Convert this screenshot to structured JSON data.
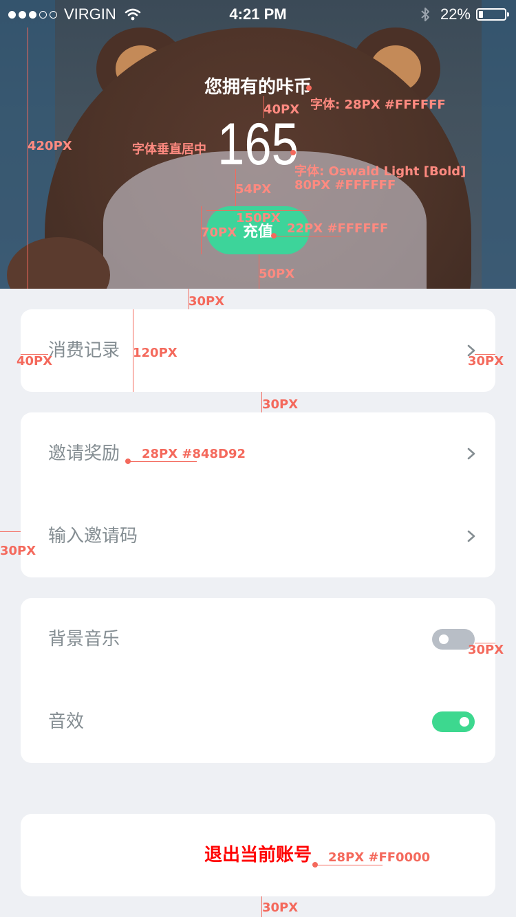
{
  "status_bar": {
    "carrier": "VIRGIN",
    "time": "4:21 PM",
    "battery": "22%",
    "battery_level": 0.22,
    "signal_bars": 3,
    "icons": [
      "wifi-icon",
      "bluetooth-icon",
      "battery-icon"
    ]
  },
  "header": {
    "title": "您拥有的咔币",
    "coin_amount": "165",
    "recharge_label": "充值"
  },
  "menu": {
    "records_label": "消费记录",
    "invite_reward_label": "邀请奖励",
    "enter_invite_code_label": "输入邀请码"
  },
  "settings": {
    "bgm_label": "背景音乐",
    "bgm_on": false,
    "sfx_label": "音效",
    "sfx_on": true
  },
  "logout": {
    "label": "退出当前账号"
  },
  "colors": {
    "accent_green": "#3DD49A",
    "toggle_on": "#3DD88F",
    "toggle_off": "#B8BEC6",
    "label_gray": "#848D92",
    "danger_red": "#FF0000",
    "background": "#EEF0F4",
    "annotation": "#F4695C"
  },
  "annotations": {
    "hero_height": "420PX",
    "title_font": "字体: 28PX #FFFFFF",
    "gap_40": "40PX",
    "vertical_center": "字体垂直居中",
    "number_font": "字体: Oswald Light [Bold]",
    "number_size": "80PX #FFFFFF",
    "gap_54": "54PX",
    "button_width": "150PX",
    "button_height": "70PX",
    "button_font": "22PX #FFFFFF",
    "gap_50": "50PX",
    "gap_30_top": "30PX",
    "left_padding": "40PX",
    "row_height": "120PX",
    "right_padding": "30PX",
    "card_gap": "30PX",
    "label_font": "28PX #848D92",
    "side_margin": "30PX",
    "toggle_margin": "30PX",
    "logout_font": "28PX #FF0000",
    "bottom_margin": "30PX"
  }
}
